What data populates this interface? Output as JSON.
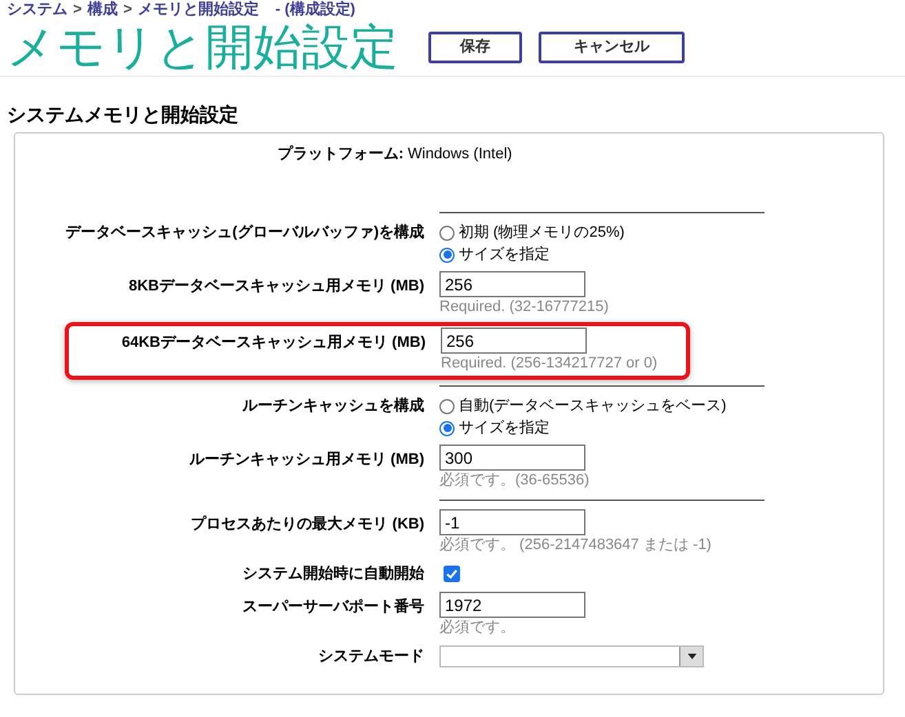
{
  "breadcrumb": {
    "items": [
      "システム",
      "構成",
      "メモリと開始設定"
    ],
    "separator": ">",
    "suffix": "- (構成設定)"
  },
  "page_title": "メモリと開始設定",
  "buttons": [
    "保存",
    "キャンセル"
  ],
  "section_title": "システムメモリと開始設定",
  "rows": [
    {
      "kind": "info",
      "label": "プラットフォーム:",
      "value": "Windows (Intel)"
    },
    {
      "kind": "divider"
    },
    {
      "kind": "radio",
      "label": "データベースキャッシュ(グローバルバッファ)を構成",
      "options": [
        {
          "label": "初期 (物理メモリの25%)",
          "selected": false
        },
        {
          "label": "サイズを指定",
          "selected": true
        }
      ]
    },
    {
      "kind": "input",
      "label": "8KBデータベースキャッシュ用メモリ (MB)",
      "value": "256",
      "hint": "Required. (32-16777215)",
      "highlighted": false
    },
    {
      "kind": "input",
      "label": "64KBデータベースキャッシュ用メモリ (MB)",
      "value": "256",
      "hint": "Required. (256-134217727 or 0)",
      "highlighted": true
    },
    {
      "kind": "divider"
    },
    {
      "kind": "radio",
      "label": "ルーチンキャッシュを構成",
      "options": [
        {
          "label": "自動(データベースキャッシュをベース)",
          "selected": false
        },
        {
          "label": "サイズを指定",
          "selected": true
        }
      ]
    },
    {
      "kind": "input",
      "label": "ルーチンキャッシュ用メモリ (MB)",
      "value": "300",
      "hint": "必須です。(36-65536)",
      "highlighted": false
    },
    {
      "kind": "divider"
    },
    {
      "kind": "input",
      "label": "プロセスあたりの最大メモリ (KB)",
      "value": "-1",
      "hint": "必須です。 (256-2147483647 または -1)",
      "highlighted": false
    },
    {
      "kind": "checkbox",
      "label": "システム開始時に自動開始",
      "checked": true
    },
    {
      "kind": "input",
      "label": "スーパーサーバポート番号",
      "value": "1972",
      "hint": "必須です。",
      "highlighted": false
    },
    {
      "kind": "select",
      "label": "システムモード"
    }
  ]
}
